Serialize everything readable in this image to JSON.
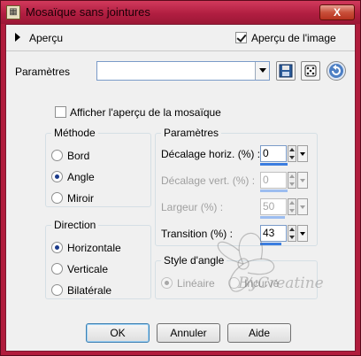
{
  "window": {
    "title": "Mosaïque sans jointures",
    "close_glyph": "X"
  },
  "preview_row": {
    "label": "Aperçu",
    "apercu_image_label": "Aperçu de l'image",
    "apercu_image_checked": true
  },
  "presets": {
    "label": "Paramètres",
    "value": ""
  },
  "show_mosaic_preview": {
    "label": "Afficher l'aperçu de la mosaïque",
    "checked": false
  },
  "methode": {
    "title": "Méthode",
    "options": [
      "Bord",
      "Angle",
      "Miroir"
    ],
    "selected": "Angle"
  },
  "parametres": {
    "title": "Paramètres",
    "decalage_horiz": {
      "label": "Décalage horiz. (%) :",
      "value": "0",
      "fill": 0.55
    },
    "decalage_vert": {
      "label": "Décalage vert. (%) :",
      "value": "0",
      "fill": 0.55
    },
    "largeur": {
      "label": "Largeur (%) :",
      "value": "50",
      "fill": 0.5
    },
    "transition": {
      "label": "Transition (%) :",
      "value": "43",
      "fill": 0.43
    }
  },
  "direction": {
    "title": "Direction",
    "options": [
      "Horizontale",
      "Verticale",
      "Bilatérale"
    ],
    "selected": "Horizontale"
  },
  "style_angle": {
    "title": "Style d'angle",
    "options": [
      "Linéaire",
      "Incurvé"
    ],
    "selected": "Linéaire"
  },
  "buttons": {
    "ok": "OK",
    "annuler": "Annuler",
    "aide": "Aide"
  },
  "watermark": {
    "text": "ByCreatine"
  },
  "colors": {
    "titlebar": "#b11e41",
    "accent_bar": "#3b7de0",
    "client_bg": "#f0f0f0"
  }
}
